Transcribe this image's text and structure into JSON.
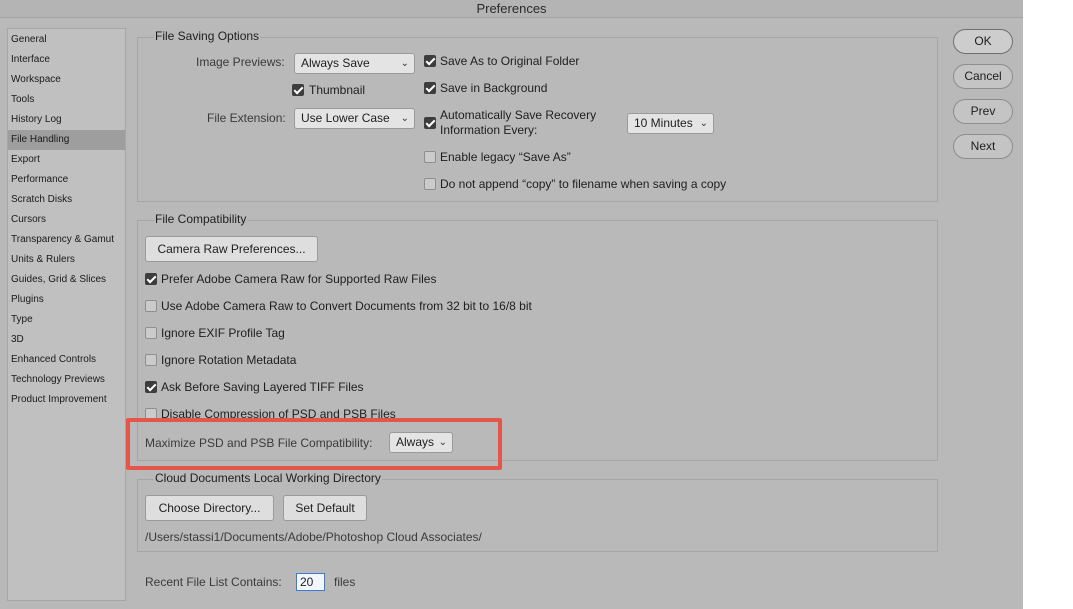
{
  "window": {
    "title": "Preferences"
  },
  "sidebar": {
    "items": [
      {
        "label": "General"
      },
      {
        "label": "Interface"
      },
      {
        "label": "Workspace"
      },
      {
        "label": "Tools"
      },
      {
        "label": "History Log"
      },
      {
        "label": "File Handling",
        "selected": true
      },
      {
        "label": "Export"
      },
      {
        "label": "Performance"
      },
      {
        "label": "Scratch Disks"
      },
      {
        "label": "Cursors"
      },
      {
        "label": "Transparency & Gamut"
      },
      {
        "label": "Units & Rulers"
      },
      {
        "label": "Guides, Grid & Slices"
      },
      {
        "label": "Plugins"
      },
      {
        "label": "Type"
      },
      {
        "label": "3D"
      },
      {
        "label": "Enhanced Controls"
      },
      {
        "label": "Technology Previews"
      },
      {
        "label": "Product Improvement"
      }
    ]
  },
  "file_saving": {
    "title": "File Saving Options",
    "image_previews_label": "Image Previews:",
    "image_previews_value": "Always Save",
    "thumbnail_label": "Thumbnail",
    "thumbnail_checked": true,
    "file_extension_label": "File Extension:",
    "file_extension_value": "Use Lower Case",
    "save_original_folder": "Save As to Original Folder",
    "save_background": "Save in Background",
    "auto_save_line1": "Automatically Save Recovery",
    "auto_save_line2": "Information Every:",
    "auto_save_interval": "10 Minutes",
    "enable_legacy": "Enable legacy “Save As”",
    "no_copy": "Do not append “copy” to filename when saving a copy"
  },
  "file_compat": {
    "title": "File Compatibility",
    "camera_raw_button": "Camera Raw Preferences...",
    "options": [
      {
        "label": "Prefer Adobe Camera Raw for Supported Raw Files",
        "checked": true
      },
      {
        "label": "Use Adobe Camera Raw to Convert Documents from 32 bit to 16/8 bit",
        "checked": false
      },
      {
        "label": "Ignore EXIF Profile Tag",
        "checked": false
      },
      {
        "label": "Ignore Rotation Metadata",
        "checked": false
      },
      {
        "label": "Ask Before Saving Layered TIFF Files",
        "checked": true
      },
      {
        "label": "Disable Compression of PSD and PSB Files",
        "checked": false
      }
    ],
    "maximize_label": "Maximize PSD and PSB File Compatibility:",
    "maximize_value": "Always"
  },
  "cloud": {
    "title": "Cloud Documents Local Working Directory",
    "choose_button": "Choose Directory...",
    "default_button": "Set Default",
    "path": "/Users/stassi1/Documents/Adobe/Photoshop Cloud Associates/"
  },
  "recent": {
    "label": "Recent File List Contains:",
    "value": "20",
    "suffix": "files"
  },
  "actions": {
    "ok": "OK",
    "cancel": "Cancel",
    "prev": "Prev",
    "next": "Next"
  },
  "colors": {
    "background": "#b9b9b9",
    "highlight": "#e5564a",
    "input_focus": "#3b7bd6"
  }
}
